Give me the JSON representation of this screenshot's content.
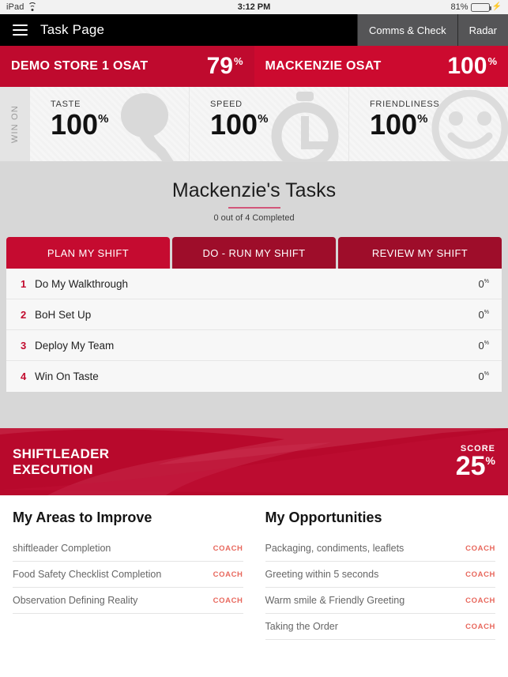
{
  "statusbar": {
    "device": "iPad",
    "wifi_icon": "wifi-icon",
    "time": "3:12 PM",
    "battery_percent": "81%",
    "charging_icon": "lightning-bolt-icon",
    "battery_level": 81
  },
  "navbar": {
    "menu_icon": "hamburger-menu-icon",
    "title": "Task Page",
    "buttons": [
      {
        "label": "Comms & Check"
      },
      {
        "label": "Radar"
      }
    ]
  },
  "osat": [
    {
      "label": "DEMO STORE 1 OSAT",
      "value": "79",
      "unit": "%"
    },
    {
      "label": "MACKENZIE OSAT",
      "value": "100",
      "unit": "%"
    }
  ],
  "win_on": {
    "side_label": "WIN ON",
    "metrics": [
      {
        "label": "TASTE",
        "value": "100",
        "unit": "%",
        "icon": "drumstick-icon"
      },
      {
        "label": "SPEED",
        "value": "100",
        "unit": "%",
        "icon": "stopwatch-icon"
      },
      {
        "label": "FRIENDLINESS",
        "value": "100",
        "unit": "%",
        "icon": "smiley-face-icon"
      }
    ]
  },
  "tasks": {
    "title": "Mackenzie's Tasks",
    "subtitle": "0 out of 4 Completed",
    "tabs": [
      {
        "label": "PLAN MY SHIFT",
        "active": true
      },
      {
        "label": "DO - RUN MY SHIFT",
        "active": false
      },
      {
        "label": "REVIEW MY SHIFT",
        "active": false
      }
    ],
    "rows": [
      {
        "num": "1",
        "name": "Do My Walkthrough",
        "pct": "0",
        "unit": "%"
      },
      {
        "num": "2",
        "name": "BoH Set Up",
        "pct": "0",
        "unit": "%"
      },
      {
        "num": "3",
        "name": "Deploy My Team",
        "pct": "0",
        "unit": "%"
      },
      {
        "num": "4",
        "name": "Win On Taste",
        "pct": "0",
        "unit": "%"
      }
    ]
  },
  "execution": {
    "title_line1": "SHIFTLEADER",
    "title_line2": "EXECUTION",
    "score_label": "SCORE",
    "score_value": "25",
    "score_unit": "%"
  },
  "bottom": {
    "improve": {
      "title": "My Areas to Improve",
      "action_label": "COACH",
      "items": [
        {
          "label": "shiftleader Completion"
        },
        {
          "label": "Food Safety Checklist Completion"
        },
        {
          "label": "Observation Defining Reality"
        }
      ]
    },
    "opportunities": {
      "title": "My Opportunities",
      "action_label": "COACH",
      "items": [
        {
          "label": "Packaging, condiments, leaflets"
        },
        {
          "label": "Greeting within 5 seconds"
        },
        {
          "label": "Warm smile & Friendly Greeting"
        },
        {
          "label": "Taking the Order"
        }
      ]
    }
  },
  "colors": {
    "brand_red": "#bf0a2e",
    "brand_red_bright": "#cc0a2f",
    "tab_active": "#c50b30",
    "tab_inactive": "#9e0d2a",
    "coach_red": "#e8685d",
    "underline_pink": "#d2567a",
    "battery_green": "#4cd964"
  }
}
